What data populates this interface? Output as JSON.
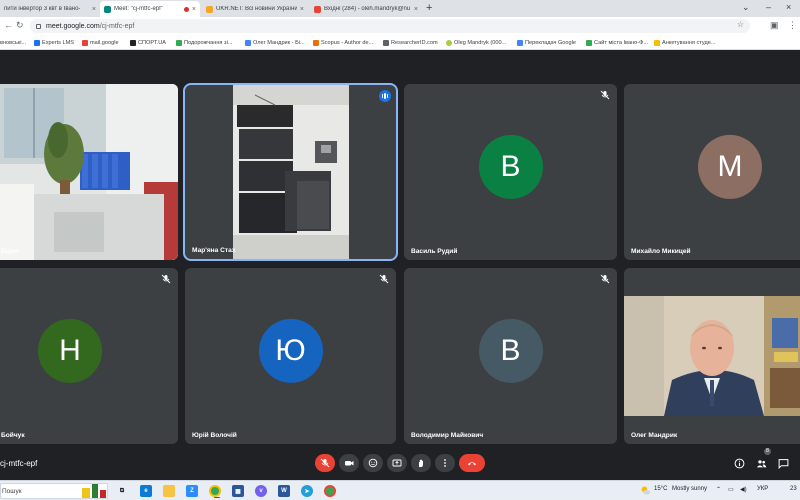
{
  "browser": {
    "tabs": [
      {
        "label": "пити інвертор 3 квт в Івано-",
        "favicon": "google-icon",
        "color": "#4285f4"
      },
      {
        "label": "Meet: \"cj-mtfc-epf\"",
        "favicon": "meet-icon",
        "color": "#00897b",
        "recording": true
      },
      {
        "label": "UKR.NET: Всі новини України, ",
        "favicon": "ukrnet-icon",
        "color": "#f5a623"
      },
      {
        "label": "Вхідні (284) - oleh.mandryk@nu",
        "favicon": "gmail-icon",
        "color": "#ea4335"
      }
    ],
    "new_tab": "+",
    "url_host": "meet.google.com",
    "url_path": "/cj-mtfc-epf",
    "bookmarks": [
      {
        "label": "вновські...",
        "color": "#888888"
      },
      {
        "label": "Experts LMS",
        "color": "#1a73e8"
      },
      {
        "label": "mail.google",
        "color": "#ea4335"
      },
      {
        "label": "СПОРТ.UA",
        "color": "#222222"
      },
      {
        "label": "Подорожчання зі...",
        "color": "#34a853"
      },
      {
        "label": "Олег Мандрик - Бі...",
        "color": "#4285f4"
      },
      {
        "label": "Scopus - Author de...",
        "color": "#e8710a"
      },
      {
        "label": "ResearcherID.com",
        "color": "#5f6368"
      },
      {
        "label": "Oleg Mandryk (000...",
        "color": "#a6ce39"
      },
      {
        "label": "Перекладач Google",
        "color": "#4285f4"
      },
      {
        "label": "Сайт міста Івано-Ф...",
        "color": "#34a853"
      },
      {
        "label": "Анкетування студе...",
        "color": "#fbbc04"
      }
    ]
  },
  "meet": {
    "participants": [
      {
        "name": "Бідко",
        "type": "video",
        "muted": false
      },
      {
        "name": "Мар'яна Стах",
        "type": "video",
        "muted": false,
        "speaking": true
      },
      {
        "name": "Василь Рудий",
        "type": "avatar",
        "initial": "В",
        "color": "#0b8043",
        "muted": true
      },
      {
        "name": "Михайло Микицей",
        "type": "avatar",
        "initial": "М",
        "color": "#8d6e63",
        "muted": false
      },
      {
        "name": "Бойчук",
        "type": "avatar",
        "initial": "Н",
        "color": "#33691e",
        "muted": true
      },
      {
        "name": "Юрій Волочій",
        "type": "avatar",
        "initial": "Ю",
        "color": "#1565c0",
        "muted": true
      },
      {
        "name": "Володимир Майкович",
        "type": "avatar",
        "initial": "В",
        "color": "#455a64",
        "muted": true
      },
      {
        "name": "Олег Мандрик",
        "type": "video",
        "muted": false
      }
    ],
    "meeting_code": "cj-mtfc-epf",
    "controls": [
      "mic-off-icon",
      "camera-icon",
      "emoji-icon",
      "present-icon",
      "raise-hand-icon",
      "more-icon",
      "hang-up-icon"
    ],
    "people_count": "8"
  },
  "taskbar": {
    "search_text": "Пошук",
    "temperature": "15°C",
    "weather": "Mostly sunny",
    "language": "УКР",
    "clock_partial": "23"
  },
  "colors": {
    "meet_bg": "#202124",
    "tile_bg": "#3c4043",
    "hangup_red": "#ea4335",
    "speaking_blue": "#8ab4f8"
  }
}
